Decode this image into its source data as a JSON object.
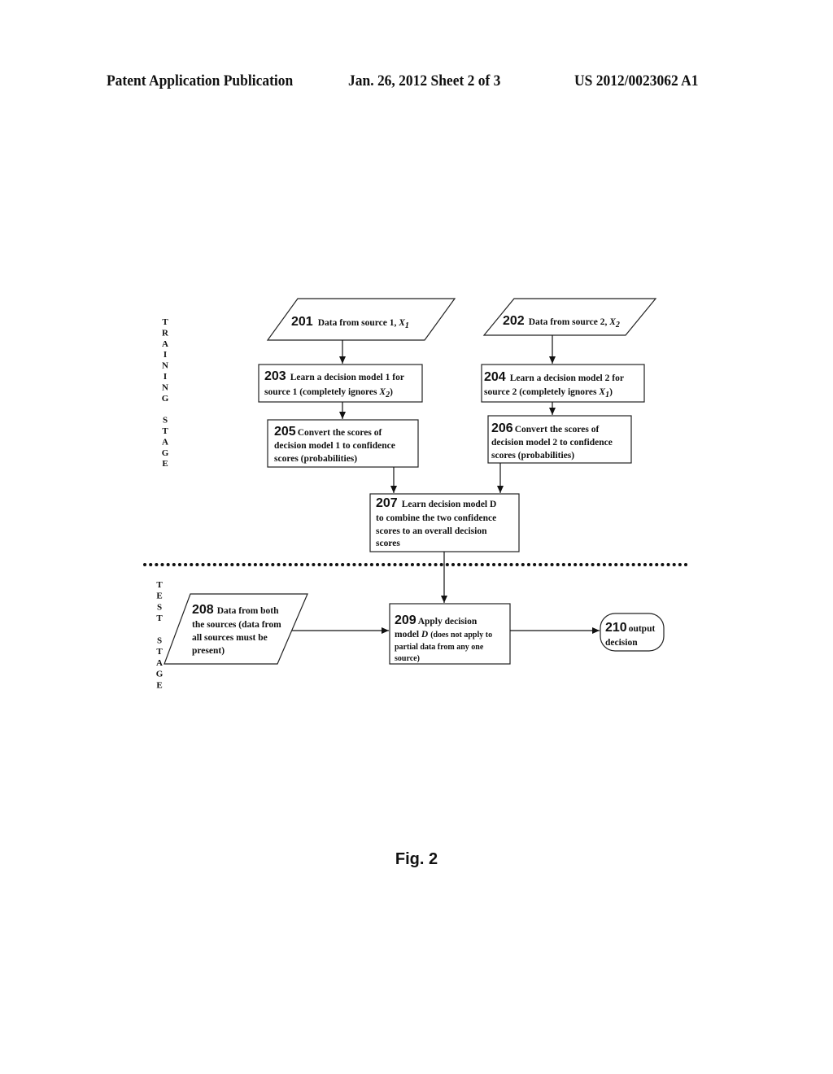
{
  "header": {
    "publication": "Patent Application Publication",
    "date_sheet": "Jan. 26, 2012   Sheet 2 of 3",
    "number": "US 2012/0023062 A1"
  },
  "stages": {
    "training": [
      "T",
      "R",
      "A",
      "I",
      "N",
      "I",
      "N",
      "G",
      "",
      "S",
      "T",
      "A",
      "G",
      "E"
    ],
    "test": [
      "T",
      "E",
      "S",
      "T",
      "",
      "S",
      "T",
      "A",
      "G",
      "E"
    ]
  },
  "nodes": {
    "n201": {
      "num": "201",
      "lines": [
        "Data from source 1, "
      ],
      "var": "X",
      "sub": "1"
    },
    "n202": {
      "num": "202",
      "lines": [
        "Data from source 2, "
      ],
      "var": "X",
      "sub": "2"
    },
    "n203": {
      "num": "203",
      "lines": [
        "Learn a decision model 1 for",
        "source 1 (completely ignores "
      ],
      "var": "X",
      "sub": "2",
      "close": ")"
    },
    "n204": {
      "num": "204",
      "lines": [
        "Learn a decision model 2 for",
        "source 2 (completely ignores "
      ],
      "var": "X",
      "sub": "1",
      "close": ")"
    },
    "n205": {
      "num": "205",
      "lines": [
        "Convert the scores of",
        "decision model 1 to confidence",
        "scores (probabilities)"
      ]
    },
    "n206": {
      "num": "206",
      "lines": [
        "Convert the scores of",
        "decision model 2 to confidence",
        "scores (probabilities)"
      ]
    },
    "n207": {
      "num": "207",
      "lines": [
        "Learn decision model D",
        "to combine the two confidence",
        "scores to an overall decision",
        "scores"
      ]
    },
    "n208": {
      "num": "208",
      "lines": [
        "Data from both",
        "the sources (data from",
        "all sources must be",
        "present)"
      ]
    },
    "n209": {
      "num": "209",
      "lines": [
        "Apply decision",
        "model ",
        "(does not apply to",
        "partial data from any one",
        "source)"
      ],
      "var": "D"
    },
    "n210": {
      "num": "210",
      "lines": [
        "output",
        "decision"
      ]
    }
  },
  "figure_label": "Fig. 2"
}
